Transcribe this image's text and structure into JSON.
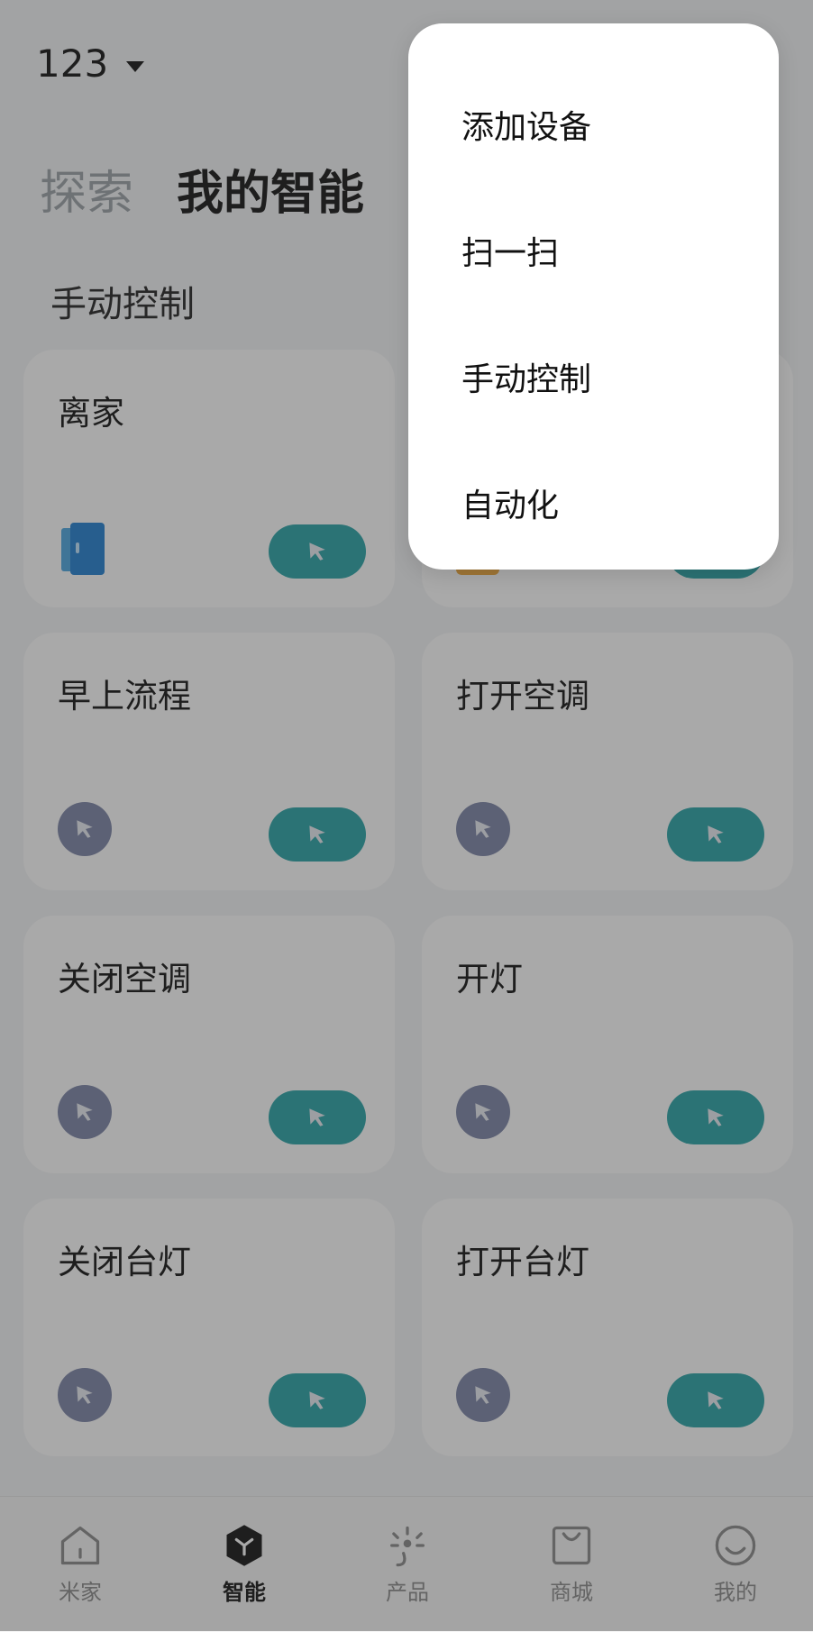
{
  "header": {
    "home_name": "123"
  },
  "tabs": [
    {
      "label": "探索"
    },
    {
      "label": "我的智能"
    }
  ],
  "section": {
    "title": "手动控制"
  },
  "cards": [
    {
      "title": "离家",
      "icon": "door-icon"
    },
    {
      "title": "",
      "icon": "hidden"
    },
    {
      "title": "早上流程",
      "icon": "cursor-icon"
    },
    {
      "title": "打开空调",
      "icon": "cursor-icon"
    },
    {
      "title": "关闭空调",
      "icon": "cursor-icon"
    },
    {
      "title": "开灯",
      "icon": "cursor-icon"
    },
    {
      "title": "关闭台灯",
      "icon": "cursor-icon"
    },
    {
      "title": "打开台灯",
      "icon": "cursor-icon"
    }
  ],
  "menu": {
    "items": [
      {
        "label": "添加设备"
      },
      {
        "label": "扫一扫"
      },
      {
        "label": "手动控制"
      },
      {
        "label": "自动化"
      }
    ]
  },
  "tabbar": {
    "items": [
      {
        "label": "米家",
        "icon": "home-icon"
      },
      {
        "label": "智能",
        "icon": "smart-icon"
      },
      {
        "label": "产品",
        "icon": "product-icon"
      },
      {
        "label": "商城",
        "icon": "shop-icon"
      },
      {
        "label": "我的",
        "icon": "profile-icon"
      }
    ]
  },
  "colors": {
    "accent": "#27a3a6",
    "icon_bg": "#7a83a6"
  }
}
